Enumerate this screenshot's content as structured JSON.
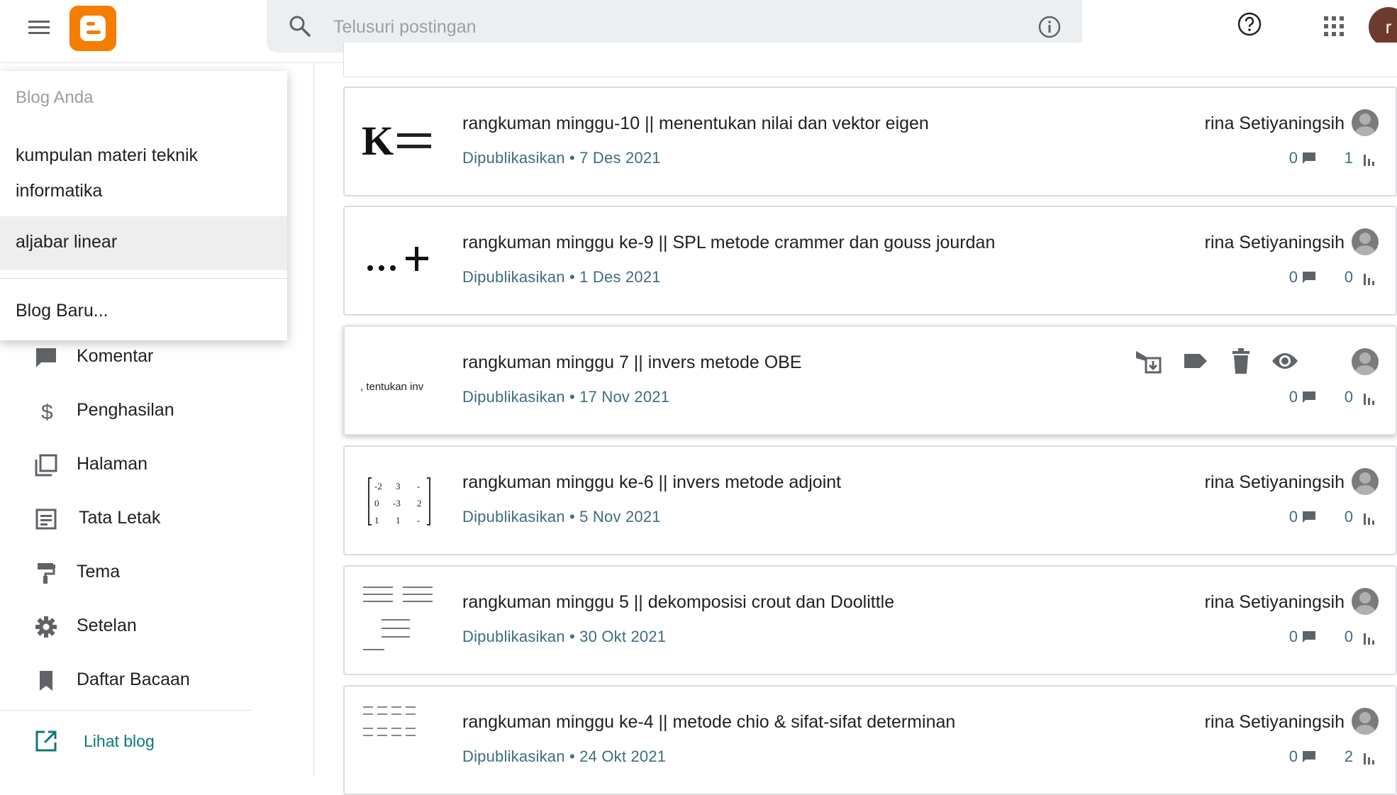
{
  "header": {
    "search_placeholder": "Telusuri postingan",
    "user_initial": "r",
    "icons": [
      "menu-icon",
      "blogger-logo",
      "search-icon",
      "info-icon",
      "help-icon",
      "apps-icon"
    ]
  },
  "dropdown": {
    "heading": "Blog Anda",
    "blogs": [
      "kumpulan materi teknik informatika",
      "aljabar linear"
    ],
    "new_blog": "Blog Baru..."
  },
  "sidebar": {
    "items": [
      {
        "label": "Komentar",
        "icon": "comment-icon"
      },
      {
        "label": "Penghasilan",
        "icon": "dollar-icon"
      },
      {
        "label": "Halaman",
        "icon": "pages-icon"
      },
      {
        "label": "Tata Letak",
        "icon": "layout-icon"
      },
      {
        "label": "Tema",
        "icon": "paint-roller-icon"
      },
      {
        "label": "Setelan",
        "icon": "gear-icon"
      },
      {
        "label": "Daftar Bacaan",
        "icon": "bookmark-icon"
      }
    ],
    "view_blog": "Lihat blog"
  },
  "posts": [
    {
      "title": "rangkuman minggu-10 || menentukan nilai dan vektor eigen",
      "meta": "Dipublikasikan • 7 Des 2021",
      "author": "rina Setiyaningsih",
      "comments": "0",
      "views": "1"
    },
    {
      "title": "rangkuman minggu ke-9 || SPL metode crammer dan gouss jourdan",
      "meta": "Dipublikasikan • 1 Des 2021",
      "author": "rina Setiyaningsih",
      "comments": "0",
      "views": "0"
    },
    {
      "title": "rangkuman minggu 7 || invers metode OBE",
      "meta": "Dipublikasikan • 17 Nov 2021",
      "author": "",
      "comments": "0",
      "views": "0",
      "thumb_text": ", tentukan inv"
    },
    {
      "title": "rangkuman minggu ke-6 || invers metode adjoint",
      "meta": "Dipublikasikan • 5 Nov 2021",
      "author": "rina Setiyaningsih",
      "comments": "0",
      "views": "0"
    },
    {
      "title": "rangkuman minggu 5 || dekomposisi crout dan Doolittle",
      "meta": "Dipublikasikan • 30 Okt 2021",
      "author": "rina Setiyaningsih",
      "comments": "0",
      "views": "0"
    },
    {
      "title": "rangkuman minggu ke-4 || metode chio & sifat-sifat determinan",
      "meta": "Dipublikasikan • 24 Okt 2021",
      "author": "rina Setiyaningsih",
      "comments": "0",
      "views": "2"
    }
  ],
  "colors": {
    "brand": "#f57d00",
    "meta_text": "#3e6e80",
    "link": "#0b7a75",
    "search_bg": "#eceff1"
  }
}
